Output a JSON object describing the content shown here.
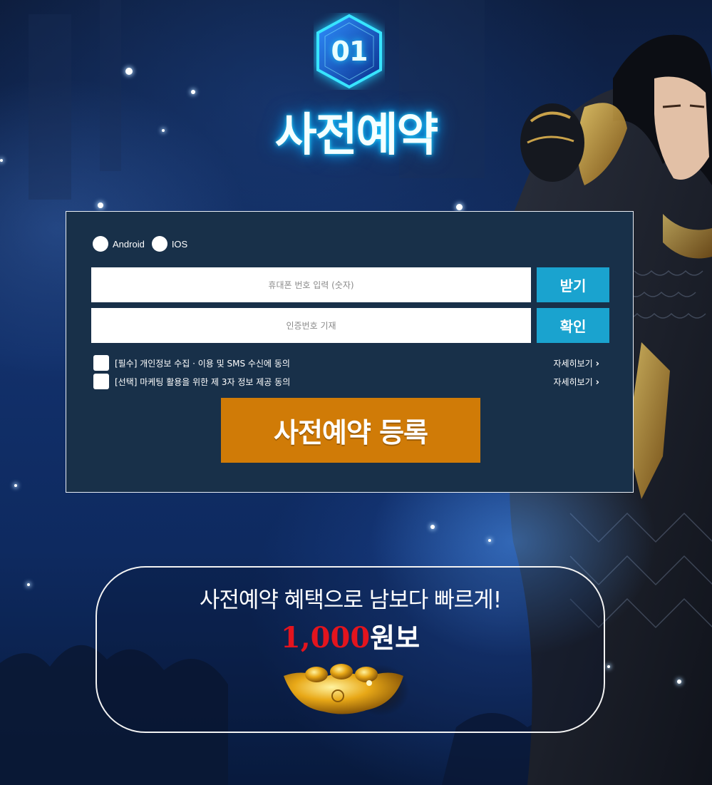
{
  "header": {
    "step_number": "01",
    "title": "사전예약"
  },
  "form": {
    "os_options": [
      {
        "label": "Android"
      },
      {
        "label": "IOS"
      }
    ],
    "phone_input": {
      "value": "",
      "placeholder": "휴대폰 번호 입력 (숫자)"
    },
    "send_button_label": "받기",
    "code_input": {
      "value": "",
      "placeholder": "인증번호 기재"
    },
    "confirm_button_label": "확인",
    "agreements": [
      {
        "label": "[필수] 개인정보 수집 · 이용 및 SMS 수신에 동의",
        "link_label": "자세히보기"
      },
      {
        "label": "[선택] 마케팅 활용을 위한 제 3자 정보 제공 동의",
        "link_label": "자세히보기"
      }
    ],
    "submit_label": "사전예약 등록"
  },
  "benefit": {
    "heading": "사전예약 혜택으로 남보다 빠르게!",
    "amount": "1,000",
    "unit": "원보"
  },
  "colors": {
    "panel_bg": "#183049",
    "button_blue": "#1aa3cf",
    "submit_orange": "#d07b07",
    "amount_red": "#e3141e"
  }
}
